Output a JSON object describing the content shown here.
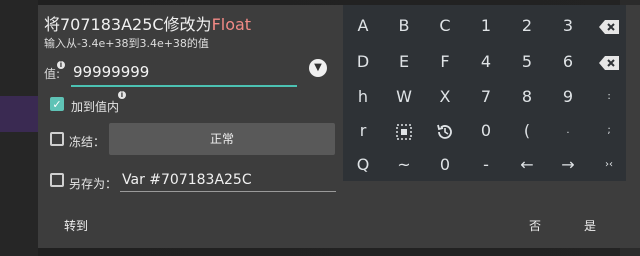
{
  "dialog": {
    "title_prefix": "将707183A25C修改为",
    "title_type": "Float",
    "subtitle": "输入从-3.4e+38到3.4e+38的值",
    "value_label": "值:",
    "value": "99999999",
    "in_value_label": "加到值内",
    "freeze_label": "冻结：",
    "freeze_mode": "正常",
    "save_as_label": "另存为：",
    "save_as_value": "Var #707183A25C",
    "goto_label": "转到",
    "no_label": "否",
    "yes_label": "是",
    "in_value_checked": true,
    "freeze_checked": false,
    "save_as_checked": false
  },
  "keyboard": {
    "rows": [
      [
        "A",
        "B",
        "C",
        "1",
        "2",
        "3",
        "backspace-icon"
      ],
      [
        "D",
        "E",
        "F",
        "4",
        "5",
        "6",
        "clear-icon"
      ],
      [
        "h",
        "W",
        "X",
        "7",
        "8",
        "9",
        ":"
      ],
      [
        "r",
        "select-icon",
        "history-icon",
        "0",
        "(",
        ".",
        ";"
      ],
      [
        "Q",
        "~",
        "0",
        "-",
        "←",
        "→",
        "›‹"
      ]
    ]
  },
  "colors": {
    "accent": "#4cc2b3",
    "type_highlight": "#f28a86",
    "dialog_bg": "#3d3d3d",
    "keyboard_bg": "#2e3236"
  }
}
